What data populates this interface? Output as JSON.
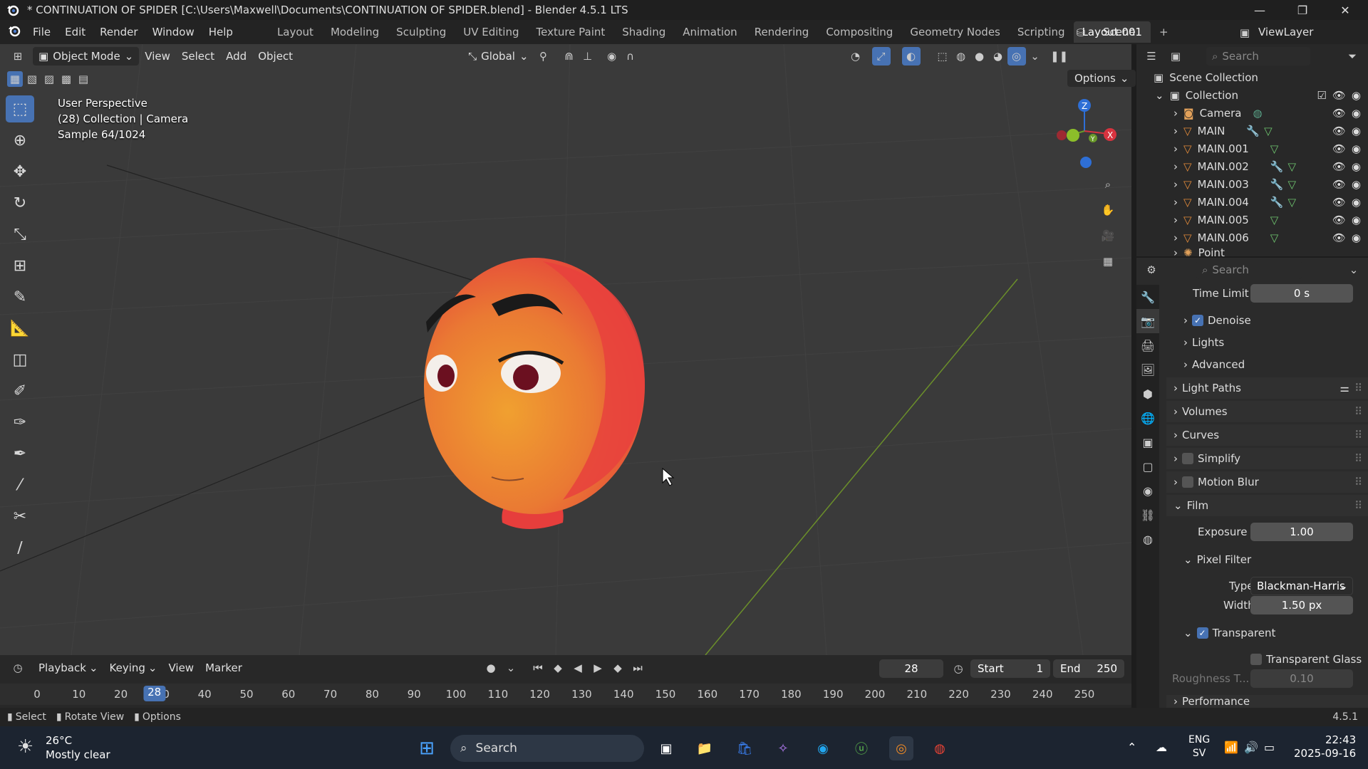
{
  "window": {
    "title": "* CONTINUATION OF SPIDER [C:\\Users\\Maxwell\\Documents\\CONTINUATION OF SPIDER.blend] - Blender 4.5.1 LTS",
    "minimize": "—",
    "maximize": "❐",
    "close": "✕"
  },
  "menu": {
    "items": [
      "File",
      "Edit",
      "Render",
      "Window",
      "Help"
    ],
    "workspaces": [
      "Layout",
      "Modeling",
      "Sculpting",
      "UV Editing",
      "Texture Paint",
      "Shading",
      "Animation",
      "Rendering",
      "Compositing",
      "Geometry Nodes",
      "Scripting",
      "Layout.001"
    ],
    "active_workspace": "Layout.001",
    "add_tab": "+",
    "scene": "Scene",
    "view_layer": "ViewLayer"
  },
  "viewport": {
    "mode": "Object Mode",
    "menus": [
      "View",
      "Select",
      "Add",
      "Object"
    ],
    "orientation": "Global",
    "options": "Options",
    "overlay_lines": [
      "User Perspective",
      "(28) Collection | Camera",
      "Sample 64/1024"
    ]
  },
  "outliner": {
    "search_placeholder": "Search",
    "scene_collection": "Scene Collection",
    "collection": "Collection",
    "objects": [
      "Camera",
      "MAIN",
      "MAIN.001",
      "MAIN.002",
      "MAIN.003",
      "MAIN.004",
      "MAIN.005",
      "MAIN.006",
      "Point"
    ]
  },
  "properties": {
    "search_placeholder": "Search",
    "time_limit_label": "Time Limit",
    "time_limit_value": "0 s",
    "denoise": "Denoise",
    "lights": "Lights",
    "advanced": "Advanced",
    "light_paths": "Light Paths",
    "volumes": "Volumes",
    "curves": "Curves",
    "simplify": "Simplify",
    "motion_blur": "Motion Blur",
    "film": "Film",
    "exposure_label": "Exposure",
    "exposure_value": "1.00",
    "pixel_filter": "Pixel Filter",
    "type_label": "Type",
    "type_value": "Blackman-Harris",
    "width_label": "Width",
    "width_value": "1.50 px",
    "transparent": "Transparent",
    "transparent_glass": "Transparent Glass",
    "roughness_label": "Roughness T...",
    "roughness_value": "0.10",
    "performance": "Performance"
  },
  "timeline": {
    "menus": [
      "Playback",
      "Keying",
      "View",
      "Marker"
    ],
    "current_frame": "28",
    "start_label": "Start",
    "start_value": "1",
    "end_label": "End",
    "end_value": "250",
    "ticks": [
      "0",
      "10",
      "20",
      "30",
      "40",
      "50",
      "60",
      "70",
      "80",
      "90",
      "100",
      "110",
      "120",
      "130",
      "140",
      "150",
      "160",
      "170",
      "180",
      "190",
      "200",
      "210",
      "220",
      "230",
      "240",
      "250"
    ]
  },
  "statusbar": {
    "select": "Select",
    "rotate": "Rotate View",
    "options": "Options",
    "version": "4.5.1"
  },
  "taskbar": {
    "temperature": "26°C",
    "weather": "Mostly clear",
    "search": "Search",
    "lang1": "ENG",
    "lang2": "SV",
    "time": "22:43",
    "date": "2025-09-16"
  }
}
